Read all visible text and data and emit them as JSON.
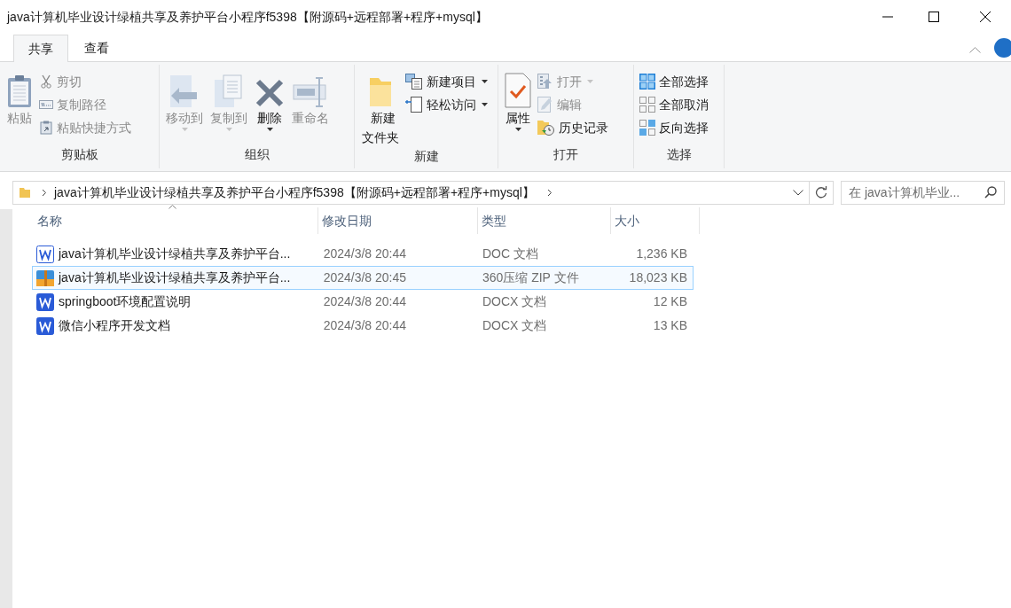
{
  "window": {
    "title": "java计算机毕业设计绿植共享及养护平台小程序f5398【附源码+远程部署+程序+mysql】"
  },
  "tabs": [
    {
      "label": "共享",
      "selected": true
    },
    {
      "label": "查看",
      "selected": false
    }
  ],
  "ribbon": {
    "groups": [
      {
        "label": "剪贴板",
        "items": [
          {
            "label": "粘贴",
            "kind": "large",
            "disabled": true,
            "dropdown": false
          },
          {
            "label": "剪切",
            "kind": "small",
            "disabled": true,
            "dropdown": false
          },
          {
            "label": "复制路径",
            "kind": "small",
            "disabled": true,
            "dropdown": false
          },
          {
            "label": "粘贴快捷方式",
            "kind": "small",
            "disabled": true,
            "dropdown": false
          }
        ]
      },
      {
        "label": "组织",
        "items": [
          {
            "label": "移动到",
            "kind": "large",
            "disabled": true,
            "dropdown": true
          },
          {
            "label": "复制到",
            "kind": "large",
            "disabled": true,
            "dropdown": true
          },
          {
            "label": "删除",
            "kind": "large",
            "disabled": false,
            "dropdown": true
          },
          {
            "label": "重命名",
            "kind": "large",
            "disabled": true,
            "dropdown": false
          }
        ]
      },
      {
        "label": "新建",
        "items": [
          {
            "label": "新建文件夹",
            "kind": "large",
            "disabled": false,
            "dropdown": false
          },
          {
            "label": "新建项目",
            "kind": "small",
            "disabled": false,
            "dropdown": true
          },
          {
            "label": "轻松访问",
            "kind": "small",
            "disabled": false,
            "dropdown": true
          }
        ]
      },
      {
        "label": "打开",
        "items": [
          {
            "label": "属性",
            "kind": "large",
            "disabled": false,
            "dropdown": true
          },
          {
            "label": "打开",
            "kind": "small",
            "disabled": true,
            "dropdown": true
          },
          {
            "label": "编辑",
            "kind": "small",
            "disabled": true,
            "dropdown": false
          },
          {
            "label": "历史记录",
            "kind": "small",
            "disabled": false,
            "dropdown": false
          }
        ]
      },
      {
        "label": "选择",
        "items": [
          {
            "label": "全部选择",
            "kind": "small",
            "disabled": false,
            "dropdown": false
          },
          {
            "label": "全部取消",
            "kind": "small",
            "disabled": false,
            "dropdown": false
          },
          {
            "label": "反向选择",
            "kind": "small",
            "disabled": false,
            "dropdown": false
          }
        ]
      }
    ]
  },
  "address": {
    "path": "java计算机毕业设计绿植共享及养护平台小程序f5398【附源码+远程部署+程序+mysql】"
  },
  "search": {
    "placeholder": "在 java计算机毕业..."
  },
  "table": {
    "columns": [
      "名称",
      "修改日期",
      "类型",
      "大小"
    ],
    "rows": [
      {
        "kind": "doc",
        "name": "java计算机毕业设计绿植共享及养护平台...",
        "modified": "2024/3/8 20:44",
        "type": "DOC 文档",
        "size": "1,236 KB",
        "selected": false
      },
      {
        "kind": "zip",
        "name": "java计算机毕业设计绿植共享及养护平台...",
        "modified": "2024/3/8 20:45",
        "type": "360压缩 ZIP 文件",
        "size": "18,023 KB",
        "selected": true
      },
      {
        "kind": "doc",
        "name": "springboot环境配置说明",
        "modified": "2024/3/8 20:44",
        "type": "DOCX 文档",
        "size": "12 KB",
        "selected": false
      },
      {
        "kind": "doc",
        "name": "微信小程序开发文档",
        "modified": "2024/3/8 20:44",
        "type": "DOCX 文档",
        "size": "13 KB",
        "selected": false
      }
    ]
  }
}
